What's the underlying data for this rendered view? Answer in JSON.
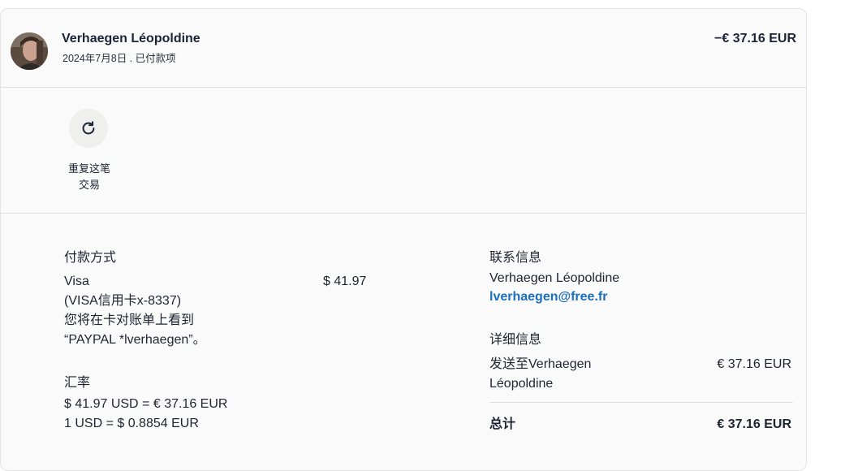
{
  "header": {
    "name": "Verhaegen Léopoldine",
    "subline": "2024年7月8日 . 已付款项",
    "amount": "−€ 37.16 EUR"
  },
  "actions": {
    "repeat_line1": "重复这笔",
    "repeat_line2": "交易",
    "repeat_icon": "refresh-icon"
  },
  "payment": {
    "title": "付款方式",
    "method": "Visa",
    "card": "(VISA信用卡x-8337)",
    "statement_line1": "您将在卡对账单上看到",
    "statement_line2": "“PAYPAL *lverhaegen”。",
    "amount": "$ 41.97"
  },
  "exchange": {
    "title": "汇率",
    "line1": "$ 41.97 USD = € 37.16 EUR",
    "line2": "1 USD = $ 0.8854 EUR"
  },
  "contact": {
    "title": "联系信息",
    "name": "Verhaegen Léopoldine",
    "email": "lverhaegen@free.fr"
  },
  "details": {
    "title": "详细信息",
    "sent_to_line1": "发送至Verhaegen",
    "sent_to_line2": "Léopoldine",
    "sent_amount": "€ 37.16 EUR",
    "total_label": "总计",
    "total_amount": "€ 37.16 EUR"
  },
  "colors": {
    "link": "#1a6fbf",
    "text": "#1f2430",
    "card_bg": "#fafafa"
  }
}
